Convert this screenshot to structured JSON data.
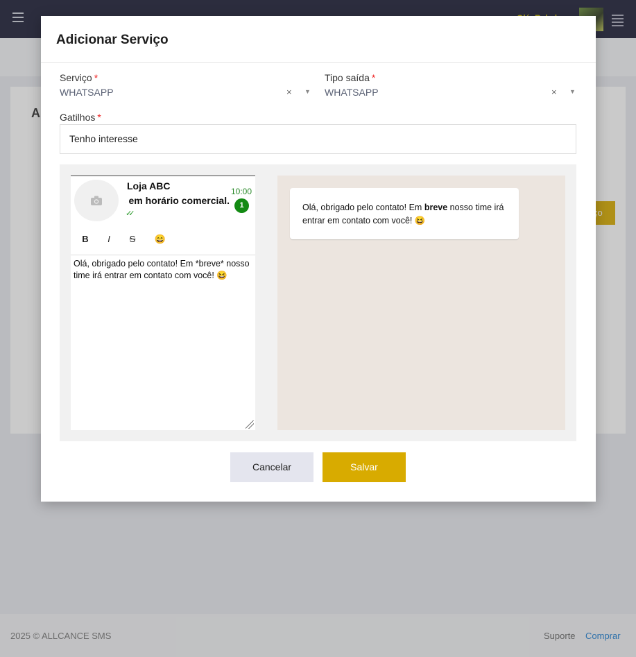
{
  "background": {
    "user_name": "Olá, Rakel",
    "page_title": "A",
    "action_button": "ço",
    "footer": {
      "copyright": "2025 © ALLCANCE SMS",
      "support": "Suporte",
      "buy": "Comprar"
    }
  },
  "modal": {
    "title": "Adicionar Serviço",
    "servico": {
      "label": "Serviço",
      "required": "*",
      "value": "WHATSAPP",
      "clear": "×",
      "caret": "▼"
    },
    "tipo_saida": {
      "label": "Tipo saída",
      "required": "*",
      "value": "WHATSAPP",
      "clear": "×",
      "caret": "▼"
    },
    "gatilhos": {
      "label": "Gatilhos",
      "required": "*",
      "value": "Tenho interesse"
    },
    "editor": {
      "contact_name": "Loja ABC",
      "last_message": "Olá! Estamos em horário comercial.",
      "ticks": "✓✓",
      "time": "10:00",
      "unread": "1",
      "toolbar": {
        "bold": "B",
        "italic": "I",
        "strike": "S",
        "emoji": "😄"
      },
      "text": "Olá, obrigado pelo contato! Em *breve* nosso time irá entrar em contato com você! 😆"
    },
    "preview": {
      "before": "Olá, obrigado pelo contato! Em ",
      "bold": "breve",
      "after": " nosso time irá entrar em contato com você! 😆"
    },
    "buttons": {
      "cancel": "Cancelar",
      "save": "Salvar"
    }
  },
  "colors": {
    "accent": "#d8ab00",
    "topbar": "#1d1f37",
    "badge": "#138a13",
    "link": "#1f7fd2"
  }
}
